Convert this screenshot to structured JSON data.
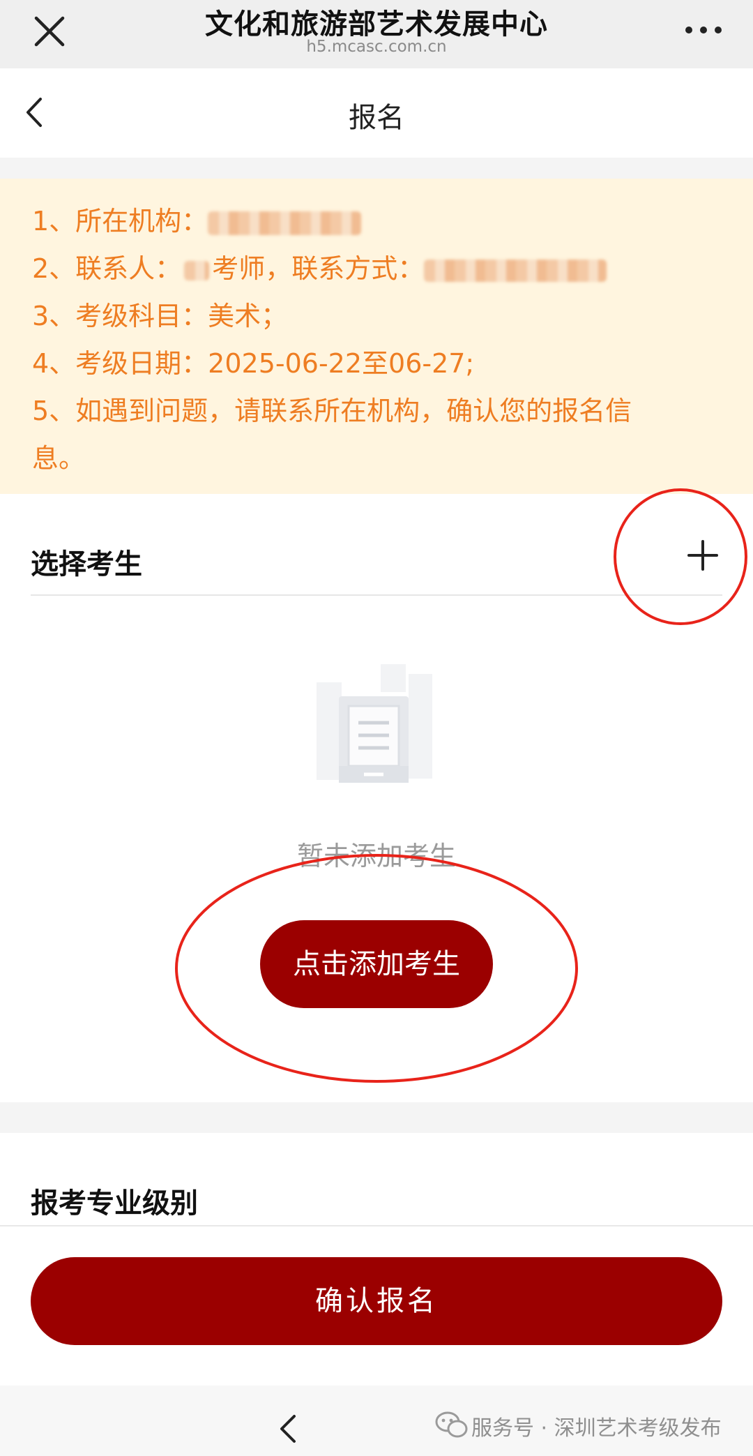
{
  "topbar": {
    "title": "文化和旅游部艺术发展中心",
    "url": "h5.mcasc.com.cn"
  },
  "navbar": {
    "title": "报名"
  },
  "notice": {
    "lines": [
      "1、所在机构：",
      "2、联系人：",
      "考师，联系方式：",
      "3、考级科目：美术；",
      "4、考级日期：2025-06-22至06-27;",
      "5、如遇到问题，请联系所在机构，确认您的报名信",
      "息。"
    ]
  },
  "candidate_section": {
    "title": "选择考生",
    "empty_text": "暂未添加考生",
    "add_button": "点击添加考生"
  },
  "level_section": {
    "title": "报考专业级别"
  },
  "confirm_button": "确认报名",
  "watermark": "服务号 · 深圳艺术考级发布",
  "colors": {
    "brand_red": "#9b0000",
    "notice_text": "#ee7d22",
    "notice_bg": "#fff5df",
    "annotation": "#e8231a"
  }
}
